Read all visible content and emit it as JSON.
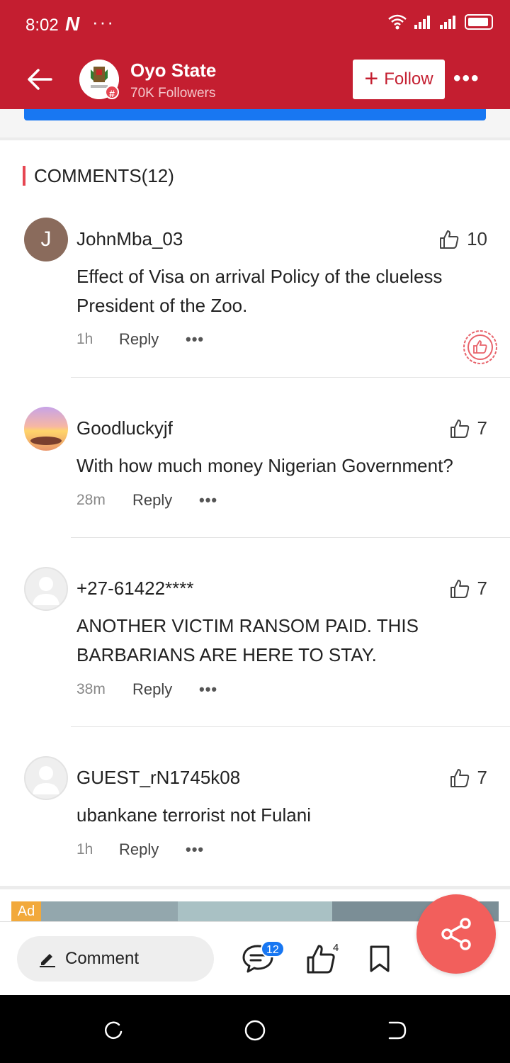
{
  "status_bar": {
    "time": "8:02",
    "app_mark": "N",
    "overflow": "···"
  },
  "header": {
    "channel_name": "Oyo State",
    "followers": "70K Followers",
    "follow_label": "Follow",
    "more": "•••",
    "badge": "#"
  },
  "comments_section": {
    "title": "COMMENTS(12)",
    "accent": "#e64652",
    "items": [
      {
        "user": "JohnMba_03",
        "avatar_letter": "J",
        "likes": "10",
        "text": "Effect of Visa on arrival Policy of the clueless President of the Zoo.",
        "time": "1h",
        "reply": "Reply",
        "more": "•••"
      },
      {
        "user": "Goodluckyjf",
        "likes": "7",
        "text": "With how much money Nigerian Government?",
        "time": "28m",
        "reply": "Reply",
        "more": "•••"
      },
      {
        "user": "+27-61422****",
        "likes": "7",
        "text": "ANOTHER VICTIM RANSOM PAID. THIS BARBARIANS ARE HERE TO STAY.",
        "time": "38m",
        "reply": "Reply",
        "more": "•••"
      },
      {
        "user": "GUEST_rN1745k08",
        "likes": "7",
        "text": "ubankane terrorist not Fulani",
        "time": "1h",
        "reply": "Reply",
        "more": "•••"
      }
    ]
  },
  "ad": {
    "tag": "Ad"
  },
  "bottom_bar": {
    "comment_label": "Comment",
    "comment_count": "12",
    "like_count": "4"
  },
  "colors": {
    "brand": "#c41e30",
    "accent_blue": "#1877f2",
    "share_fab": "#f25f5c"
  }
}
